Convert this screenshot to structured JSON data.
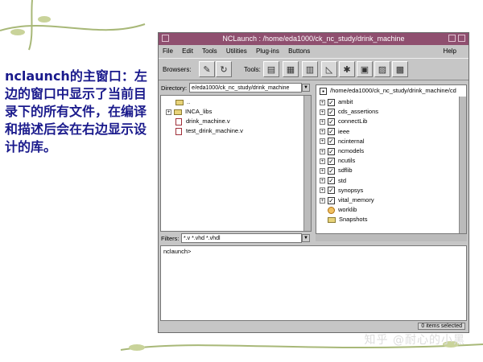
{
  "caption": {
    "keyword": "nclaunch",
    "text": "的主窗口：左边的窗口中显示了当前目录下的所有文件，在编译和描述后会在右边显示设计的库。"
  },
  "window": {
    "title": "NCLaunch : /home/eda1000/ck_nc_study/drink_machine",
    "menu": [
      "File",
      "Edit",
      "Tools",
      "Utilities",
      "Plug-ins",
      "Buttons"
    ],
    "help": "Help",
    "browsers_label": "Browsers:",
    "tools_label": "Tools:",
    "directory_label": "Directory:",
    "directory_value": "e/eda1000/ck_nc_study/drink_machine",
    "left_items": [
      {
        "label": "..",
        "kind": "folder",
        "expand": false
      },
      {
        "label": "INCA_libs",
        "kind": "folder",
        "expand": true
      },
      {
        "label": "drink_machine.v",
        "kind": "file",
        "expand": false
      },
      {
        "label": "test_drink_machine.v",
        "kind": "file",
        "expand": false
      }
    ],
    "right_header": "/home/eda1000/ck_nc_study/drink_machine/cd",
    "right_items": [
      "ambit",
      "cds_assertions",
      "connectLib",
      "ieee",
      "ncinternal",
      "ncmodels",
      "ncutils",
      "sdflib",
      "std",
      "synopsys",
      "vital_memory"
    ],
    "right_worklib": "worklib",
    "right_snapshots": "Snapshots",
    "filters_label": "Filters:",
    "filters_value": "*.v *.vhd *.vhdl",
    "console_prompt": "nclaunch>",
    "status": "0 items selected"
  },
  "watermark": "知乎 @耐心的小黑",
  "colors": {
    "titlebar": "#8f4f6f",
    "window_bg": "#c6c6c6",
    "caption": "#1a1a8c"
  }
}
